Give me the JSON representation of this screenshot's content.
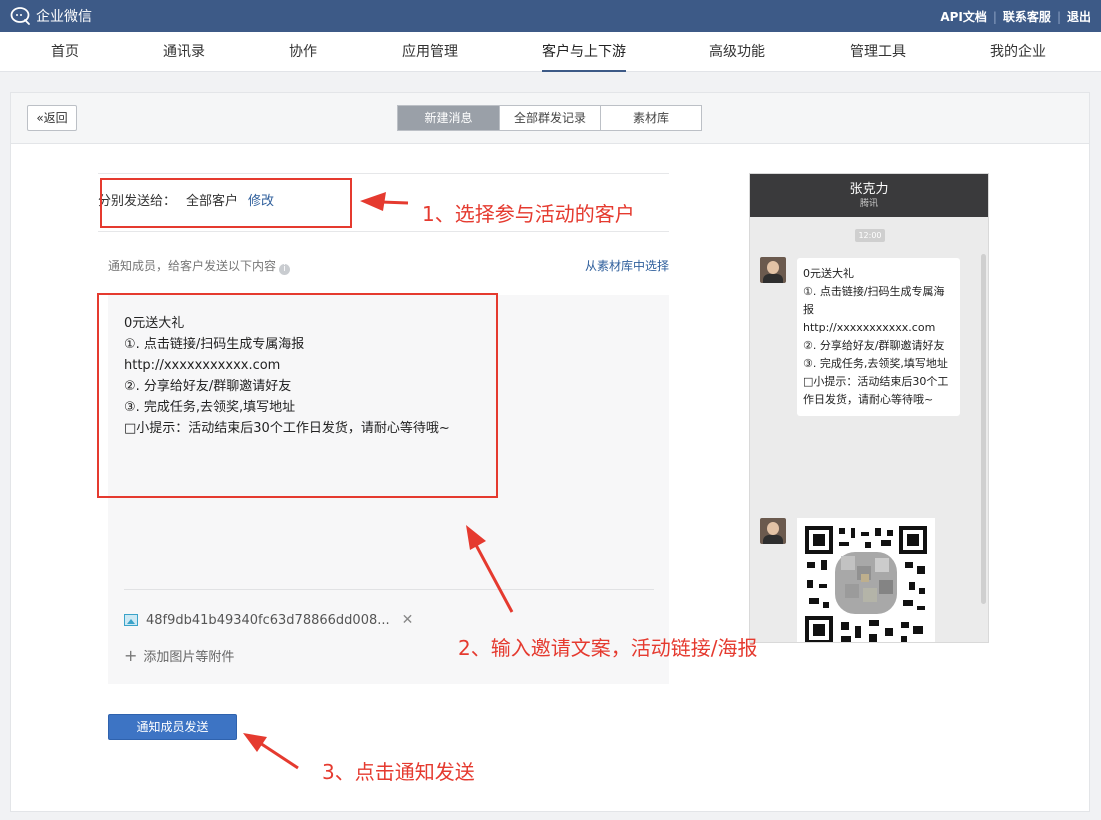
{
  "topbar": {
    "logo_text": "企业微信",
    "links": [
      "API文档",
      "联系客服",
      "退出"
    ]
  },
  "nav": {
    "items": [
      "首页",
      "通讯录",
      "协作",
      "应用管理",
      "客户与上下游",
      "高级功能",
      "管理工具",
      "我的企业"
    ],
    "active": "客户与上下游"
  },
  "panel": {
    "back_label": "返回",
    "tabs": [
      "新建消息",
      "全部群发记录",
      "素材库"
    ],
    "active_tab": "新建消息"
  },
  "compose": {
    "recipients_label": "分别发送给：",
    "recipients_value": "全部客户",
    "modify_link": "修改",
    "hint": "通知成员，给客户发送以下内容",
    "pick_from_library": "从素材库中选择",
    "message_lines": [
      "0元送大礼",
      "",
      "①. 点击链接/扫码生成专属海报",
      "http://xxxxxxxxxxx.com",
      "②. 分享给好友/群聊邀请好友",
      "③. 完成任务,去领奖,填写地址",
      "",
      "□小提示：活动结束后30个工作日发货，请耐心等待哦~"
    ],
    "attachment_name": "48f9db41b49340fc63d78866dd008...",
    "remove_symbol": "✕",
    "add_attachment": "添加图片等附件",
    "send_button": "通知成员发送"
  },
  "preview": {
    "contact_name": "张克力",
    "contact_company": "腾讯",
    "time": "12:00",
    "bubble_lines": [
      "0元送大礼",
      "",
      "①. 点击链接/扫码生成专属海报",
      "http://xxxxxxxxxxx.com",
      "②. 分享给好友/群聊邀请好友",
      "③. 完成任务,去领奖,填写地址",
      "",
      "□小提示：活动结束后30个工作日发货，请耐心等待哦~"
    ]
  },
  "annotations": {
    "step1": "1、选择参与活动的客户",
    "step2": "2、输入邀请文案，活动链接/海报",
    "step3": "3、点击通知发送",
    "color": "#e53a2f"
  },
  "colors": {
    "topbar": "#3d5a87",
    "link": "#2f5f9c",
    "primary_button": "#3d74c4",
    "active_tab": "#9aa0a8"
  }
}
